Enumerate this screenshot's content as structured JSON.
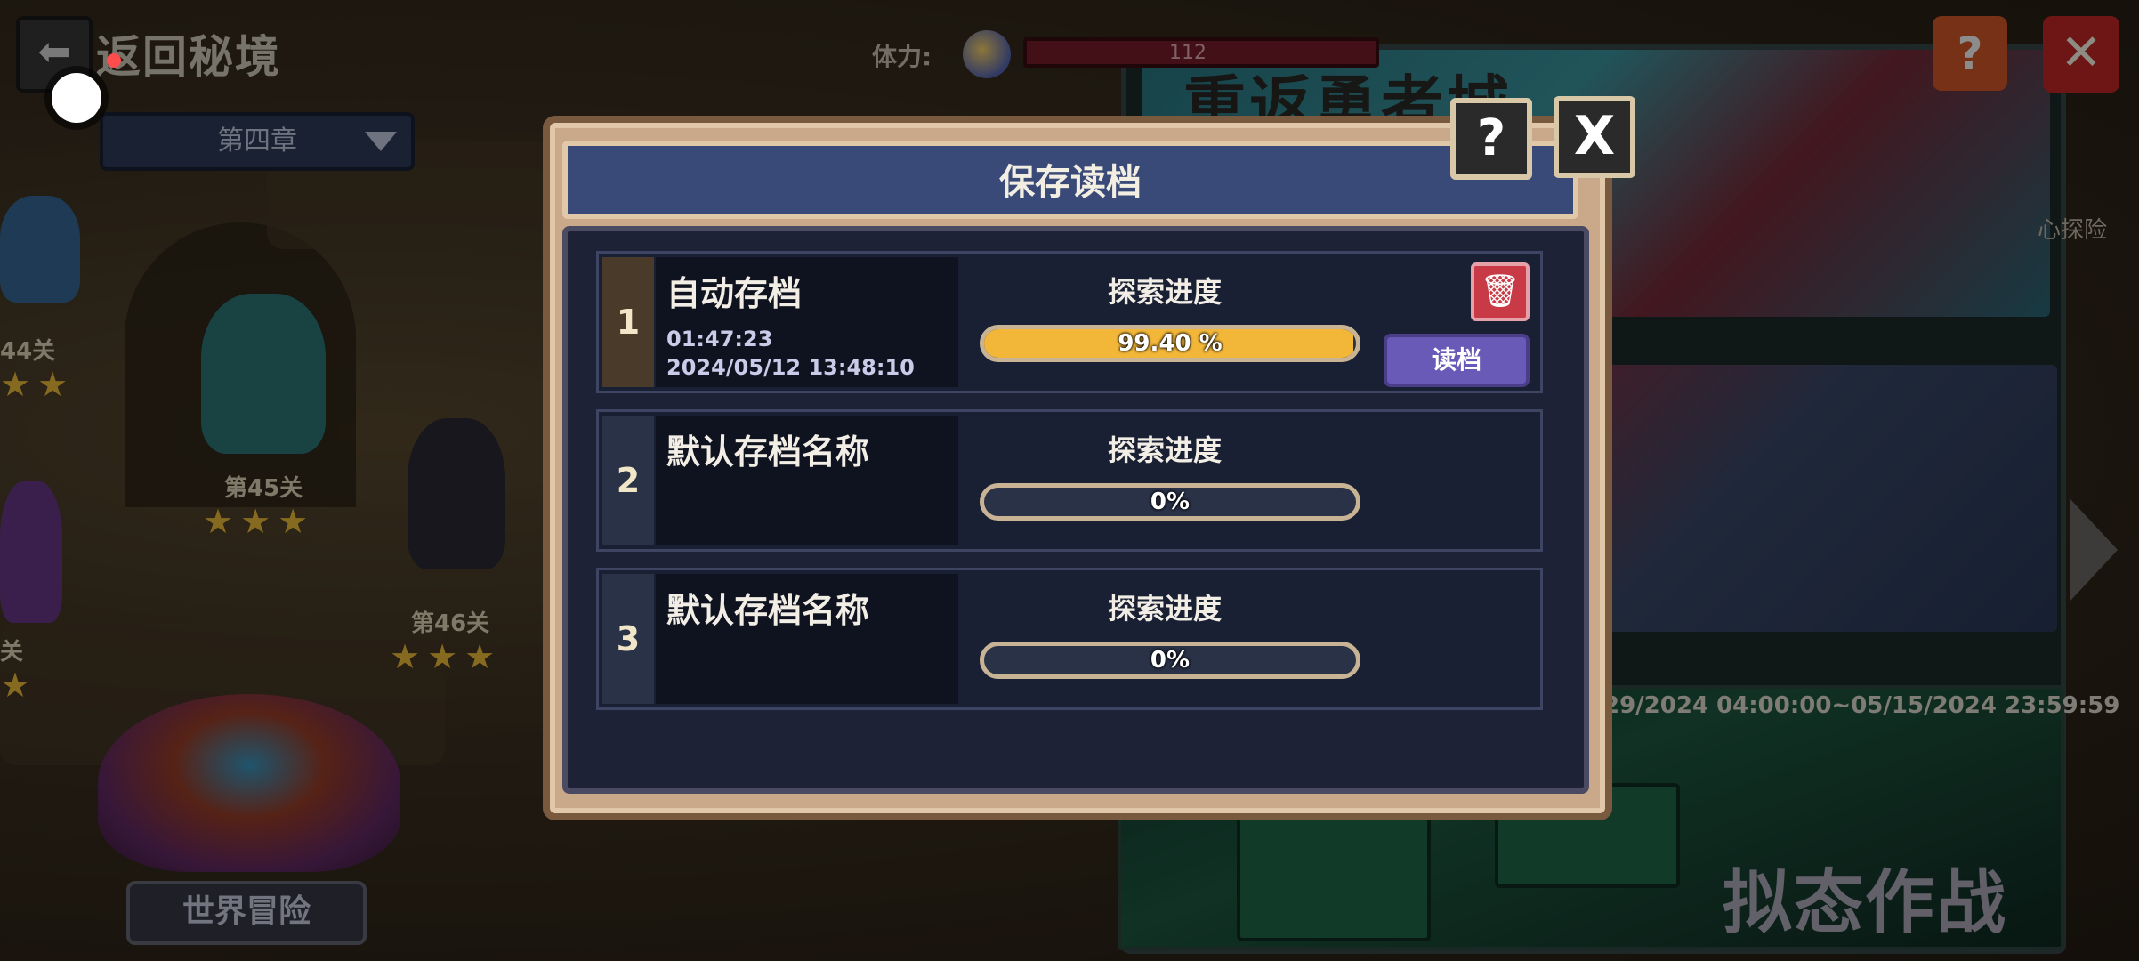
{
  "header": {
    "back_label": "返回",
    "title": "返回秘境",
    "chapter": "第四章",
    "stamina_label": "体力:",
    "stamina_value": "112"
  },
  "stages": [
    {
      "label": "44关",
      "stars": "★★"
    },
    {
      "label": "第45关",
      "stars": "★★★"
    },
    {
      "label": "第46关",
      "stars": "★★★"
    },
    {
      "label": "关",
      "stars": "★"
    }
  ],
  "world_button": "世界冒险",
  "right_panel": {
    "banner_title": "重返勇者城",
    "side_text": "心探险",
    "date_range": "29/2024 04:00:00~05/15/2024 23:59:59",
    "signboard": "拟态作战"
  },
  "modal": {
    "title": "保存读档",
    "help_icon": "?",
    "close_icon": "X",
    "slots": [
      {
        "num": "1",
        "name": "自动存档",
        "time": "01:47:23",
        "date": "2024/05/12 13:48:10",
        "progress_label": "探索进度",
        "progress_text": "99.40 %",
        "progress": 99.4,
        "load_label": "读档",
        "delete_icon": "trash-icon"
      },
      {
        "num": "2",
        "name": "默认存档名称",
        "progress_label": "探索进度",
        "progress_text": "0%",
        "progress": 0
      },
      {
        "num": "3",
        "name": "默认存档名称",
        "progress_label": "探索进度",
        "progress_text": "0%",
        "progress": 0
      }
    ]
  },
  "colors": {
    "progress_fill": "#f2b638",
    "load_button": "#6a5ab8",
    "delete_button": "#c83a46",
    "modal_header": "#3a4a78"
  }
}
